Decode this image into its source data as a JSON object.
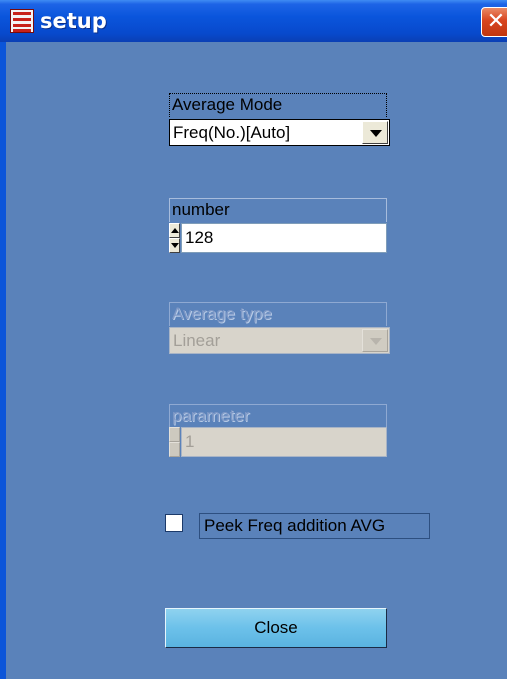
{
  "window": {
    "title": "setup",
    "close_glyph": "✕",
    "icon": "app-icon"
  },
  "average_mode": {
    "label": "Average Mode",
    "selected": "Freq(No.)[Auto]"
  },
  "number": {
    "label": "number",
    "value": "128"
  },
  "average_type": {
    "label": "Average type",
    "selected": "Linear",
    "enabled": false
  },
  "parameter": {
    "label": "parameter",
    "value": "1",
    "enabled": false
  },
  "peek_freq": {
    "label": "Peek Freq addition AVG",
    "checked": false
  },
  "close_button": {
    "label": "Close"
  },
  "colors": {
    "titlebar": "#0a55dc",
    "client_background": "#5a82ba",
    "button_face": "#6cc1ea",
    "close_x": "#d8451f"
  }
}
